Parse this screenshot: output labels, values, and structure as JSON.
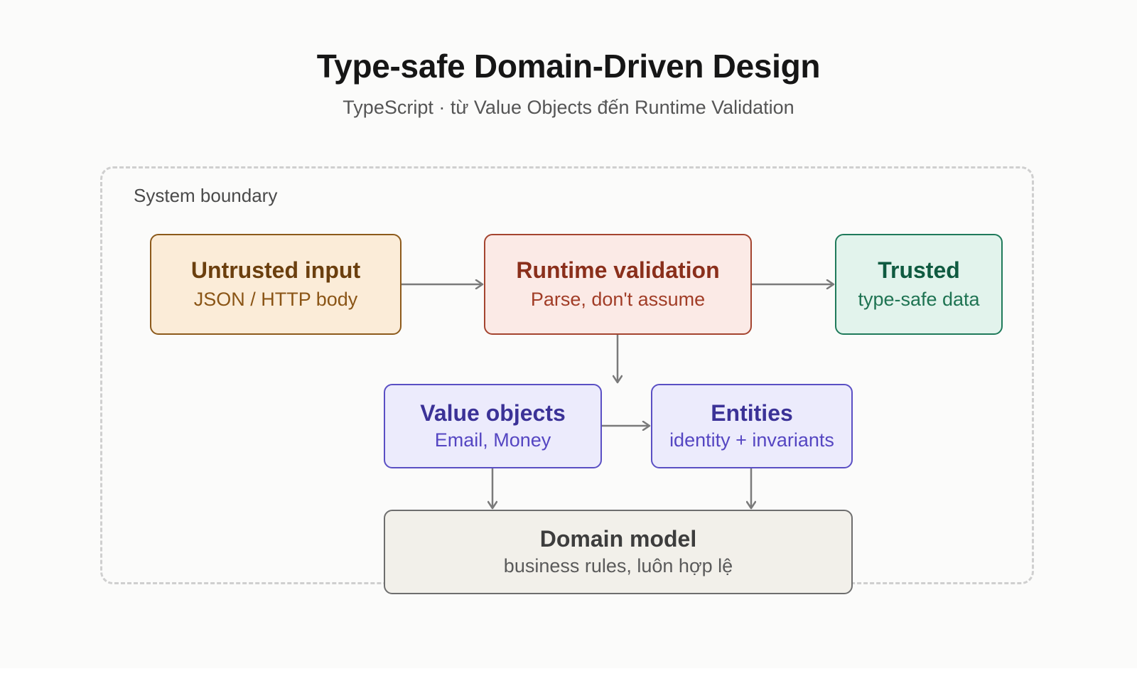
{
  "header": {
    "title": "Type-safe Domain-Driven Design",
    "subtitle": "TypeScript · từ Value Objects đến Runtime Validation"
  },
  "boundary": {
    "label": "System boundary"
  },
  "nodes": {
    "untrusted": {
      "title": "Untrusted input",
      "subtitle": "JSON / HTTP body"
    },
    "runtime": {
      "title": "Runtime validation",
      "subtitle": "Parse, don't assume"
    },
    "trusted": {
      "title": "Trusted",
      "subtitle": "type-safe data"
    },
    "value_objects": {
      "title": "Value objects",
      "subtitle": "Email, Money"
    },
    "entities": {
      "title": "Entities",
      "subtitle": "identity + invariants"
    },
    "domain": {
      "title": "Domain model",
      "subtitle": "business rules, luôn hợp lệ"
    }
  },
  "edges": [
    {
      "from": "untrusted",
      "to": "runtime"
    },
    {
      "from": "runtime",
      "to": "trusted"
    },
    {
      "from": "runtime",
      "to": "value_objects"
    },
    {
      "from": "value_objects",
      "to": "entities"
    },
    {
      "from": "value_objects",
      "to": "domain"
    },
    {
      "from": "entities",
      "to": "domain"
    }
  ],
  "colors": {
    "untrusted": "#8c5a1b",
    "runtime": "#a4442f",
    "trusted": "#1f7a5a",
    "value_objects": "#5a4fc4",
    "entities": "#5a4fc4",
    "domain": "#6e6e6e",
    "arrow": "#7a7a7a"
  }
}
